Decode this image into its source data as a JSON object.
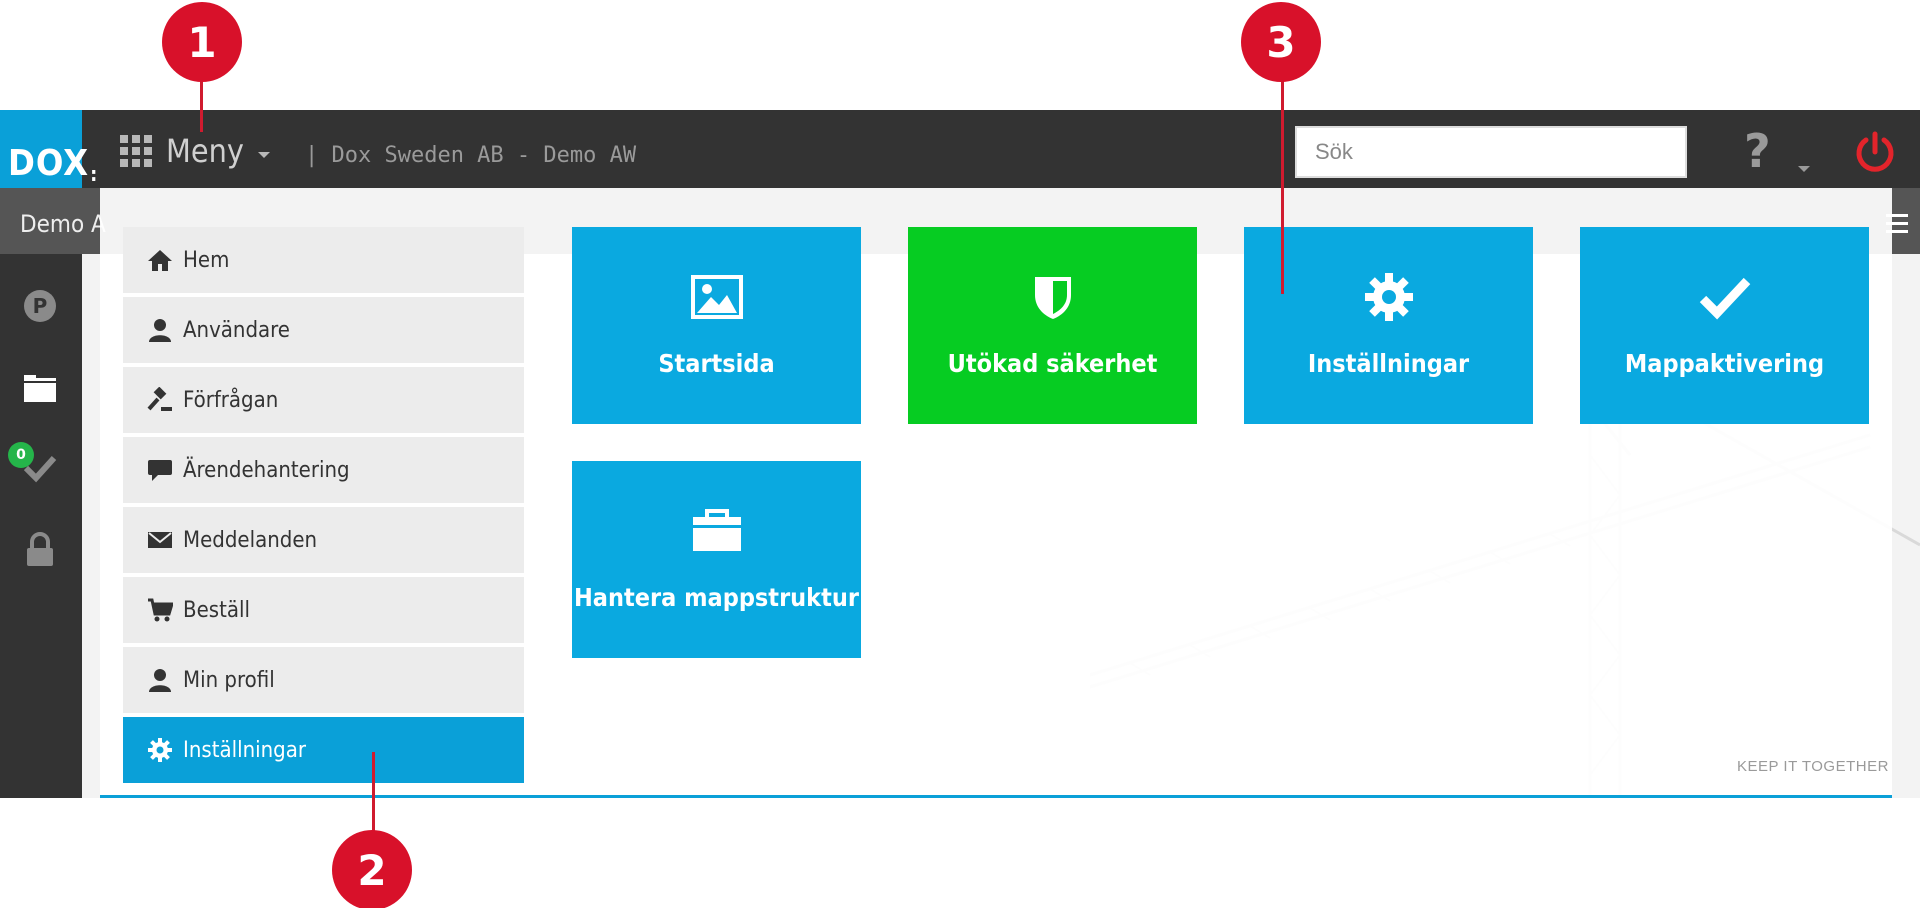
{
  "header": {
    "logo_text": "DOX",
    "menu_label": "Meny",
    "company": "| Dox Sweden AB - Demo AW",
    "search_placeholder": "Sök",
    "help_symbol": "?"
  },
  "subheader": {
    "title": "Demo A"
  },
  "sidebar": {
    "task_badge": "0"
  },
  "left_menu": [
    {
      "label": "Hem",
      "icon": "home-icon"
    },
    {
      "label": "Användare",
      "icon": "user-icon"
    },
    {
      "label": "Förfrågan",
      "icon": "gavel-icon"
    },
    {
      "label": "Ärendehantering",
      "icon": "comment-icon"
    },
    {
      "label": "Meddelanden",
      "icon": "envelope-icon"
    },
    {
      "label": "Beställ",
      "icon": "cart-icon"
    },
    {
      "label": "Min profil",
      "icon": "user-icon"
    },
    {
      "label": "Inställningar",
      "icon": "gear-icon",
      "active": true
    }
  ],
  "tiles": [
    {
      "label": "Startsida",
      "icon": "image-icon",
      "color": "#0aa9e0"
    },
    {
      "label": "Utökad säkerhet",
      "icon": "shield-icon",
      "color": "#06cc22"
    },
    {
      "label": "Inställningar",
      "icon": "gear-icon",
      "color": "#0aa9e0"
    },
    {
      "label": "Mappaktivering",
      "icon": "check-icon",
      "color": "#0aa9e0"
    },
    {
      "label": "Hantera mappstruktur",
      "icon": "folder-icon",
      "color": "#0aa9e0"
    }
  ],
  "tagline": "KEEP IT TOGETHER",
  "callouts": [
    "1",
    "2",
    "3"
  ],
  "colors": {
    "accent": "#0aa0d8",
    "green": "#06cc22",
    "callout": "#d8112a",
    "topbar": "#333333"
  }
}
